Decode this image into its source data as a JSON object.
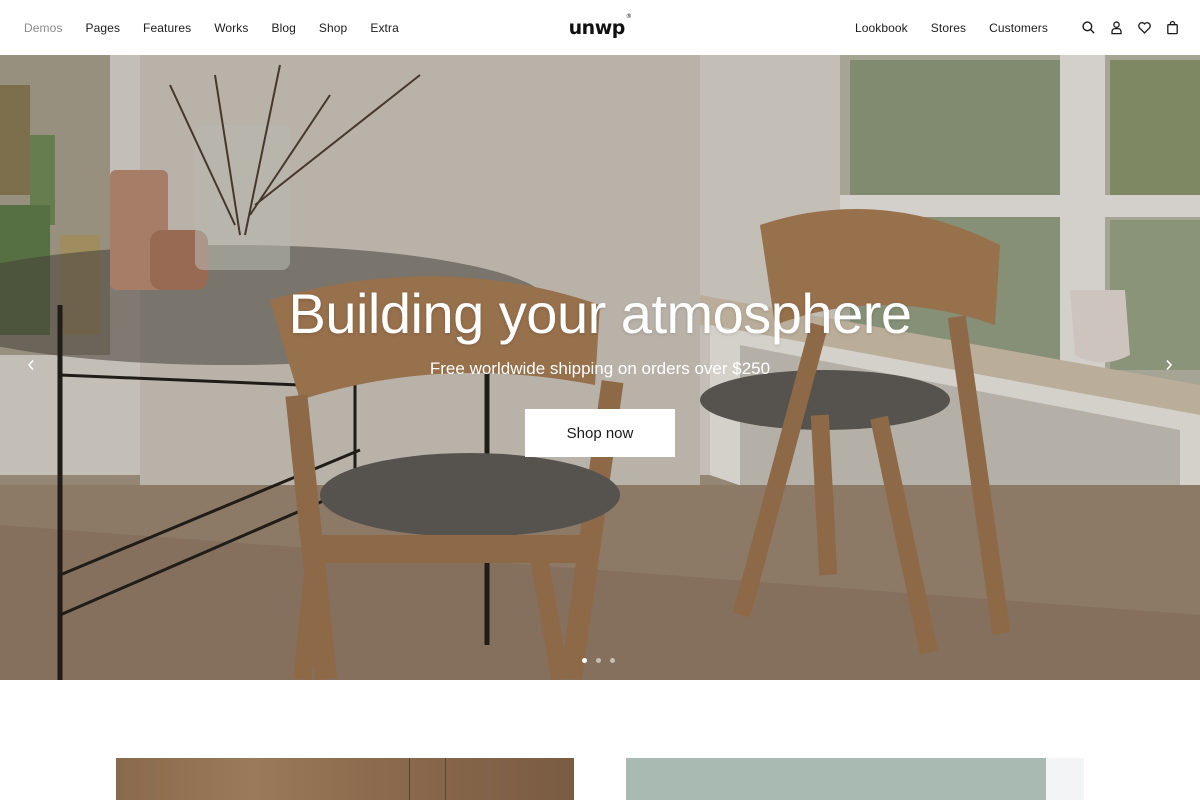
{
  "header": {
    "logo": "unwp",
    "logo_mark": "®",
    "nav_left": [
      "Demos",
      "Pages",
      "Features",
      "Works",
      "Blog",
      "Shop",
      "Extra"
    ],
    "nav_right": [
      "Lookbook",
      "Stores",
      "Customers"
    ],
    "icons": [
      "search-icon",
      "user-icon",
      "heart-icon",
      "bag-icon"
    ]
  },
  "hero": {
    "title": "Building your atmosphere",
    "subtitle": "Free worldwide shipping on orders over $250",
    "cta_label": "Shop now",
    "slide_count": 3,
    "active_slide": 1,
    "icons": [
      "chevron-left-icon",
      "chevron-right-icon"
    ]
  },
  "colors": {
    "text": "#1c1c1c",
    "muted_nav": "#8a8a8a",
    "button_bg": "#ffffff",
    "card_sage": "#a9bab2"
  }
}
